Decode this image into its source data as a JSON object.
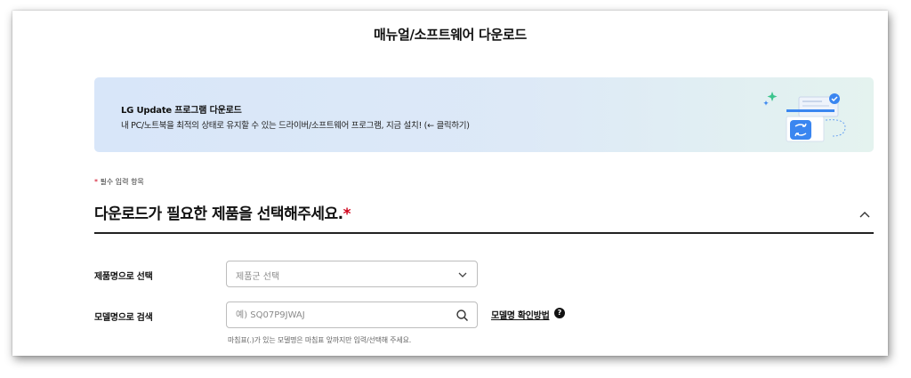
{
  "page": {
    "title": "매뉴얼/소프트웨어 다운로드"
  },
  "banner": {
    "title": "LG Update 프로그램 다운로드",
    "description": "내 PC/노트북을 최적의 상태로 유지할 수 있는 드라이버/소프트웨어 프로그램, 지금 설치! (← 클릭하기)",
    "illustration_icon": "sync-app-icon",
    "accent_color": "#3a86f0"
  },
  "form": {
    "required_star": "*",
    "required_note": "필수 입력 항목",
    "section_title": "다운로드가 필요한 제품을 선택해주세요.",
    "collapse_icon": "chevron-up-icon",
    "product_row": {
      "label": "제품명으로 선택",
      "select_placeholder": "제품군 선택"
    },
    "model_row": {
      "label": "모델명으로 검색",
      "input_placeholder": "예) SQ07P9JWAJ",
      "input_value": "",
      "search_icon": "search-icon",
      "howto_link": "모델명 확인방법",
      "help_icon_text": "?"
    },
    "hint": "마침표(.)가 있는 모델명은 마침표 앞까지만 입력/선택해 주세요."
  },
  "colors": {
    "required": "#d0021b",
    "banner_start": "#d8e6f9",
    "banner_end": "#e4f3ef"
  }
}
